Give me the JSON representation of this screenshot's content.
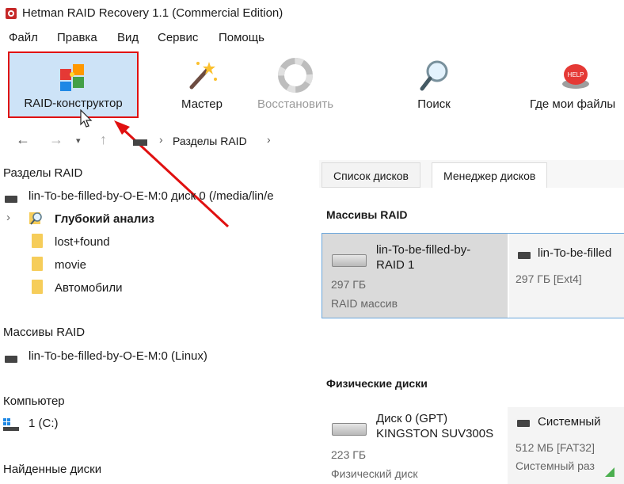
{
  "window": {
    "title": "Hetman RAID Recovery 1.1 (Commercial Edition)"
  },
  "menu": [
    "Файл",
    "Правка",
    "Вид",
    "Сервис",
    "Помощь"
  ],
  "toolbar": {
    "raid_constructor": "RAID-конструктор",
    "wizard": "Мастер",
    "restore": "Восстановить",
    "search": "Поиск",
    "where_files": "Где мои файлы"
  },
  "breadcrumb": {
    "location": "Разделы RAID"
  },
  "left_panel": {
    "raid_partitions": {
      "heading": "Разделы RAID",
      "volume": "lin-To-be-filled-by-O-E-M:0 диск 0 (/media/lin/e",
      "deep_analysis": "Глубокий анализ",
      "folders": [
        "lost+found",
        "movie",
        "Автомобили"
      ]
    },
    "raid_arrays": {
      "heading": "Массивы RAID",
      "item": "lin-To-be-filled-by-O-E-M:0 (Linux)"
    },
    "computer": {
      "heading": "Компьютер",
      "item": "1 (C:)"
    },
    "found_disks": {
      "heading": "Найденные диски"
    }
  },
  "right_panel": {
    "tabs": [
      "Список дисков",
      "Менеджер дисков"
    ],
    "raid_arrays": {
      "title": "Массивы RAID",
      "card": {
        "name_line1": "lin-To-be-filled-by-",
        "name_line2": "RAID 1",
        "size": "297 ГБ",
        "type": "RAID массив"
      },
      "partition": {
        "name": "lin-To-be-filled",
        "info": "297 ГБ [Ext4]"
      }
    },
    "physical_disks": {
      "title": "Физические диски",
      "card": {
        "name_line1": "Диск 0 (GPT)",
        "name_line2": "KINGSTON SUV300S",
        "size": "223 ГБ",
        "type": "Физический диск"
      },
      "partition": {
        "name": "Системный",
        "info": "512 МБ [FAT32]",
        "type": "Системный раз"
      }
    }
  },
  "colors": {
    "highlight": "#cde3f7",
    "annotation_red": "#e01010",
    "folder": "#f6cd5a"
  }
}
